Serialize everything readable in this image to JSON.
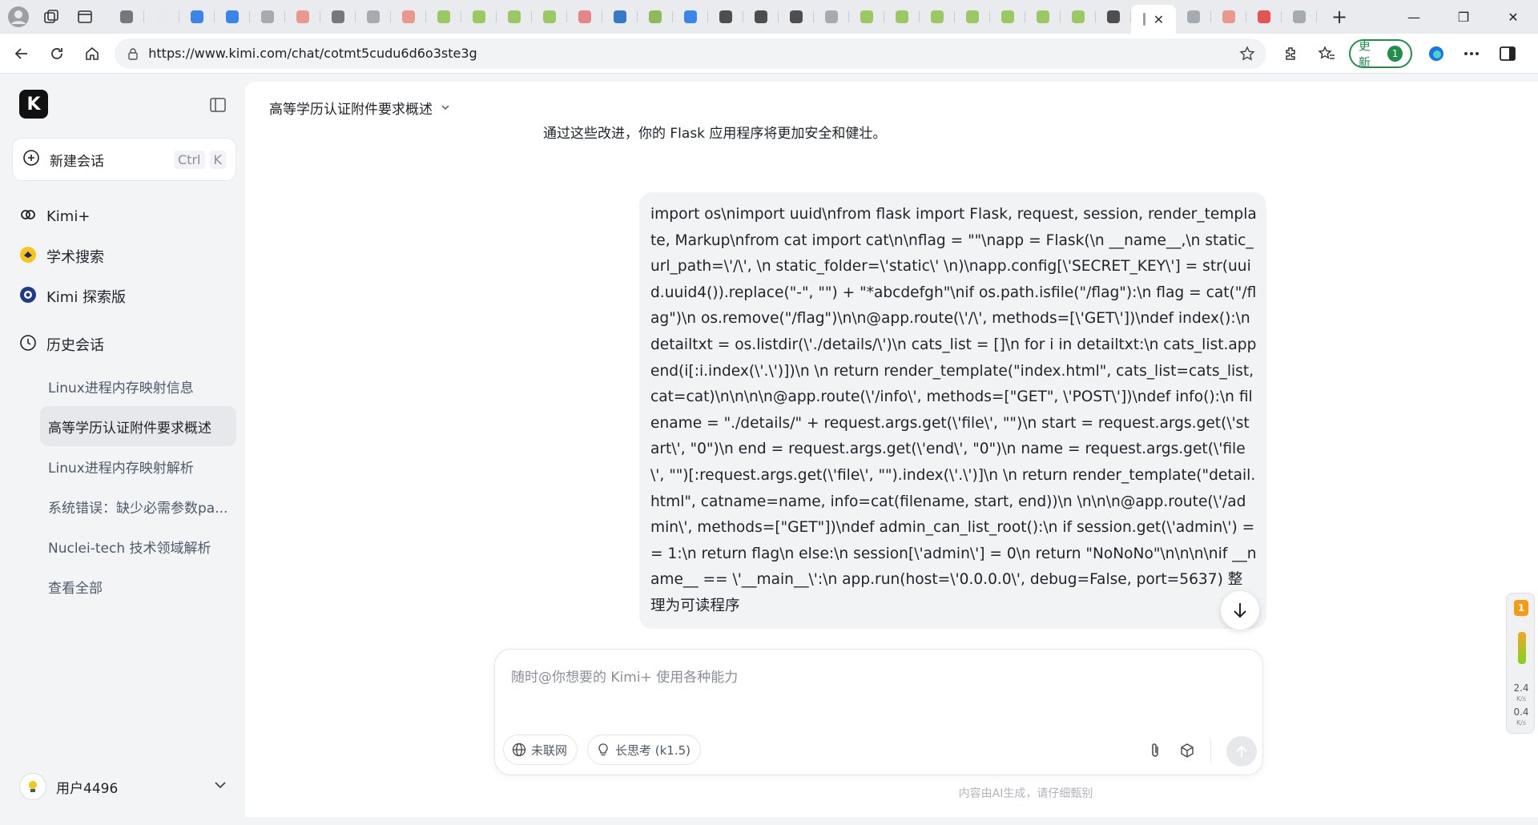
{
  "browser": {
    "url": "https://www.kimi.com/chat/cotmt5cudu6d6o3ste3g",
    "update_label": "更新",
    "update_badge": "1",
    "tab_count": 34,
    "accent": "#1f8f4a"
  },
  "sidebar": {
    "logo": "K",
    "new_chat": {
      "label": "新建会话",
      "shortcut": [
        "Ctrl",
        "K"
      ]
    },
    "nav": [
      {
        "label": "Kimi+",
        "icon": "kimi-plus-icon"
      },
      {
        "label": "学术搜索",
        "icon": "academic-search-icon"
      },
      {
        "label": "Kimi 探索版",
        "icon": "explore-icon"
      },
      {
        "label": "历史会话",
        "icon": "clock-icon"
      }
    ],
    "history": [
      "Linux进程内存映射信息",
      "高等学历认证附件要求概述",
      "Linux进程内存映射解析",
      "系统错误：缺少必需参数pa...",
      "Nuclei-tech 技术领域解析",
      "查看全部"
    ],
    "user": {
      "name": "用户4496"
    }
  },
  "chat": {
    "title": "高等学历认证附件要求概述",
    "previous_text": "通过这些改进，你的 Flask 应用程序将更加安全和健壮。",
    "message": "import os\\nimport uuid\\nfrom flask import Flask, request, session, render_template, Markup\\nfrom cat import cat\\n\\nflag = \"\"\\napp = Flask(\\n    __name__,\\n    static_url_path=\\'/\\', \\n    static_folder=\\'static\\' \\n)\\napp.config[\\'SECRET_KEY\\'] = str(uuid.uuid4()).replace(\"-\", \"\") + \"*abcdefgh\"\\nif os.path.isfile(\"/flag\"):\\n    flag = cat(\"/flag\")\\n    os.remove(\"/flag\")\\n\\n@app.route(\\'/\\', methods=[\\'GET\\'])\\ndef index():\\n    detailtxt = os.listdir(\\'./details/\\')\\n    cats_list = []\\n    for i in detailtxt:\\n        cats_list.append(i[:i.index(\\'.\\')])\\n        \\n    return render_template(\"index.html\", cats_list=cats_list, cat=cat)\\n\\n\\n\\n@app.route(\\'/info\\', methods=[\"GET\", \\'POST\\'])\\ndef info():\\n    filename = \"./details/\" + request.args.get(\\'file\\', \"\")\\n    start = request.args.get(\\'start\\', \"0\")\\n    end = request.args.get(\\'end\\', \"0\")\\n    name = request.args.get(\\'file\\', \"\")[:request.args.get(\\'file\\', \"\").index(\\'.\\')]\\n    \\n    return render_template(\"detail.html\", catname=name, info=cat(filename, start, end))\\n    \\n\\n\\n@app.route(\\'/admin\\', methods=[\"GET\"])\\ndef admin_can_list_root():\\n    if session.get(\\'admin\\') == 1:\\n        return flag\\n    else:\\n        session[\\'admin\\'] = 0\\n        return \"NoNoNo\"\\n\\n\\n\\nif __name__ == \\'__main__\\':\\n    app.run(host=\\'0.0.0.0\\', debug=False, port=5637)   整理为可读程序",
    "composer_placeholder": "随时@你想要的 Kimi+ 使用各种能力",
    "chips": [
      {
        "label": "未联网",
        "icon": "globe-icon"
      },
      {
        "label": "长思考 (k1.5)",
        "icon": "bulb-icon"
      }
    ],
    "disclaimer": "内容由AI生成，请仔细甄别"
  },
  "widget": {
    "badge": "1",
    "up": "2.4",
    "up_unit": "K/s",
    "down": "0.4",
    "down_unit": "K/s"
  }
}
